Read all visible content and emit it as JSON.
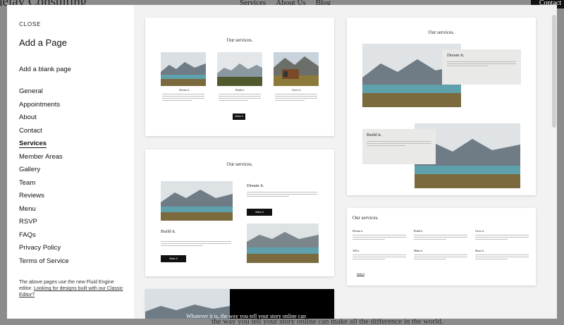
{
  "background_site": {
    "logo": "delay Consulting",
    "nav": [
      "Services",
      "About Us",
      "Blog"
    ],
    "contact": "Contact",
    "bottom_text": "the way you tell your story online can make all the difference in the world."
  },
  "sidebar": {
    "close_label": "CLOSE",
    "title": "Add a Page",
    "blank_label": "Add a blank page",
    "categories": [
      {
        "label": "General"
      },
      {
        "label": "Appointments"
      },
      {
        "label": "About"
      },
      {
        "label": "Contact"
      },
      {
        "label": "Services",
        "active": true
      },
      {
        "label": "Member Areas"
      },
      {
        "label": "Gallery"
      },
      {
        "label": "Team"
      },
      {
        "label": "Reviews"
      },
      {
        "label": "Menu"
      },
      {
        "label": "RSVP"
      },
      {
        "label": "FAQs"
      },
      {
        "label": "Privacy Policy"
      },
      {
        "label": "Terms of Service"
      }
    ],
    "note_text": "The above pages use the new Fluid Engine editor. ",
    "note_link": "Looking for designs built with our Classic Editor?"
  },
  "previews": {
    "card1": {
      "heading": "Our services.",
      "labels": [
        "Dream it.",
        "Build it.",
        "Grow it."
      ],
      "button": "Make it"
    },
    "card2": {
      "heading": "Our services.",
      "label_a": "Dream it.",
      "label_b": "Build it.",
      "button": "Make it"
    },
    "card3": {
      "heading": "Our services.",
      "label_a": "Dream it.",
      "label_b": "Build it."
    },
    "card4": {
      "heading": "Our services.",
      "labels": [
        "Dream it.",
        "Build it.",
        "Grow it.",
        "Tell it.",
        "Make it.",
        "Share it."
      ],
      "link": "Make it"
    },
    "card5": {
      "hero": "Whatever it is, the way you tell your story online can"
    }
  },
  "colors": {
    "accent": "#111111",
    "modal_bg": "#f2f2f2",
    "card_bg": "#ffffff"
  }
}
